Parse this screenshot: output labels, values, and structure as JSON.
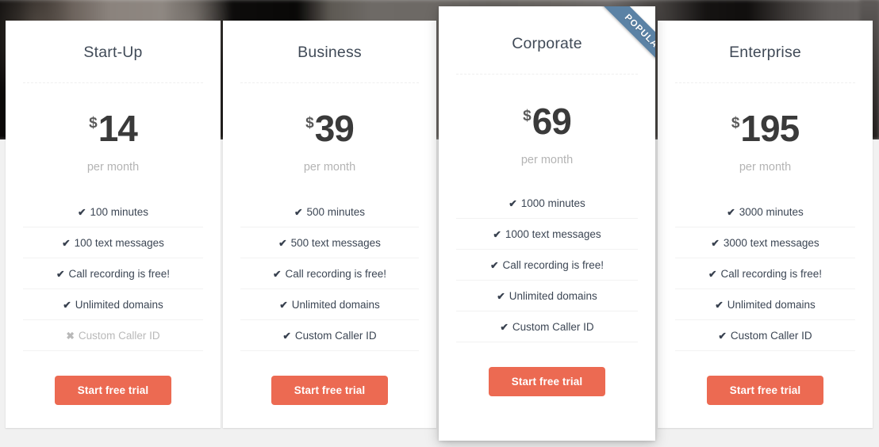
{
  "ribbon": {
    "label": "POPULAR"
  },
  "currency_symbol": "$",
  "period_label": "per month",
  "cta_label": "Start free trial",
  "icons": {
    "included": "✔",
    "excluded": "✖"
  },
  "colors": {
    "cta_background": "#ec6a52",
    "cta_text": "#ffffff",
    "ribbon_background": "#5b82a5",
    "title_text": "#404a57",
    "price_text": "#3a3a3a",
    "period_text": "#b4b4b4",
    "feature_text": "#3c4654",
    "feature_disabled_text": "#b9b9b9",
    "card_background": "#ffffff",
    "page_background": "#f1f1f1"
  },
  "plans": [
    {
      "name": "Start-Up",
      "price": "14",
      "featured": false,
      "features": [
        {
          "label": "100 minutes",
          "included": true
        },
        {
          "label": "100 text messages",
          "included": true
        },
        {
          "label": "Call recording is free!",
          "included": true
        },
        {
          "label": "Unlimited domains",
          "included": true
        },
        {
          "label": "Custom Caller ID",
          "included": false
        }
      ]
    },
    {
      "name": "Business",
      "price": "39",
      "featured": false,
      "features": [
        {
          "label": "500 minutes",
          "included": true
        },
        {
          "label": "500 text messages",
          "included": true
        },
        {
          "label": "Call recording is free!",
          "included": true
        },
        {
          "label": "Unlimited domains",
          "included": true
        },
        {
          "label": "Custom Caller ID",
          "included": true
        }
      ]
    },
    {
      "name": "Corporate",
      "price": "69",
      "featured": true,
      "features": [
        {
          "label": "1000 minutes",
          "included": true
        },
        {
          "label": "1000 text messages",
          "included": true
        },
        {
          "label": "Call recording is free!",
          "included": true
        },
        {
          "label": "Unlimited domains",
          "included": true
        },
        {
          "label": "Custom Caller ID",
          "included": true
        }
      ]
    },
    {
      "name": "Enterprise",
      "price": "195",
      "featured": false,
      "features": [
        {
          "label": "3000 minutes",
          "included": true
        },
        {
          "label": "3000 text messages",
          "included": true
        },
        {
          "label": "Call recording is free!",
          "included": true
        },
        {
          "label": "Unlimited domains",
          "included": true
        },
        {
          "label": "Custom Caller ID",
          "included": true
        }
      ]
    }
  ]
}
